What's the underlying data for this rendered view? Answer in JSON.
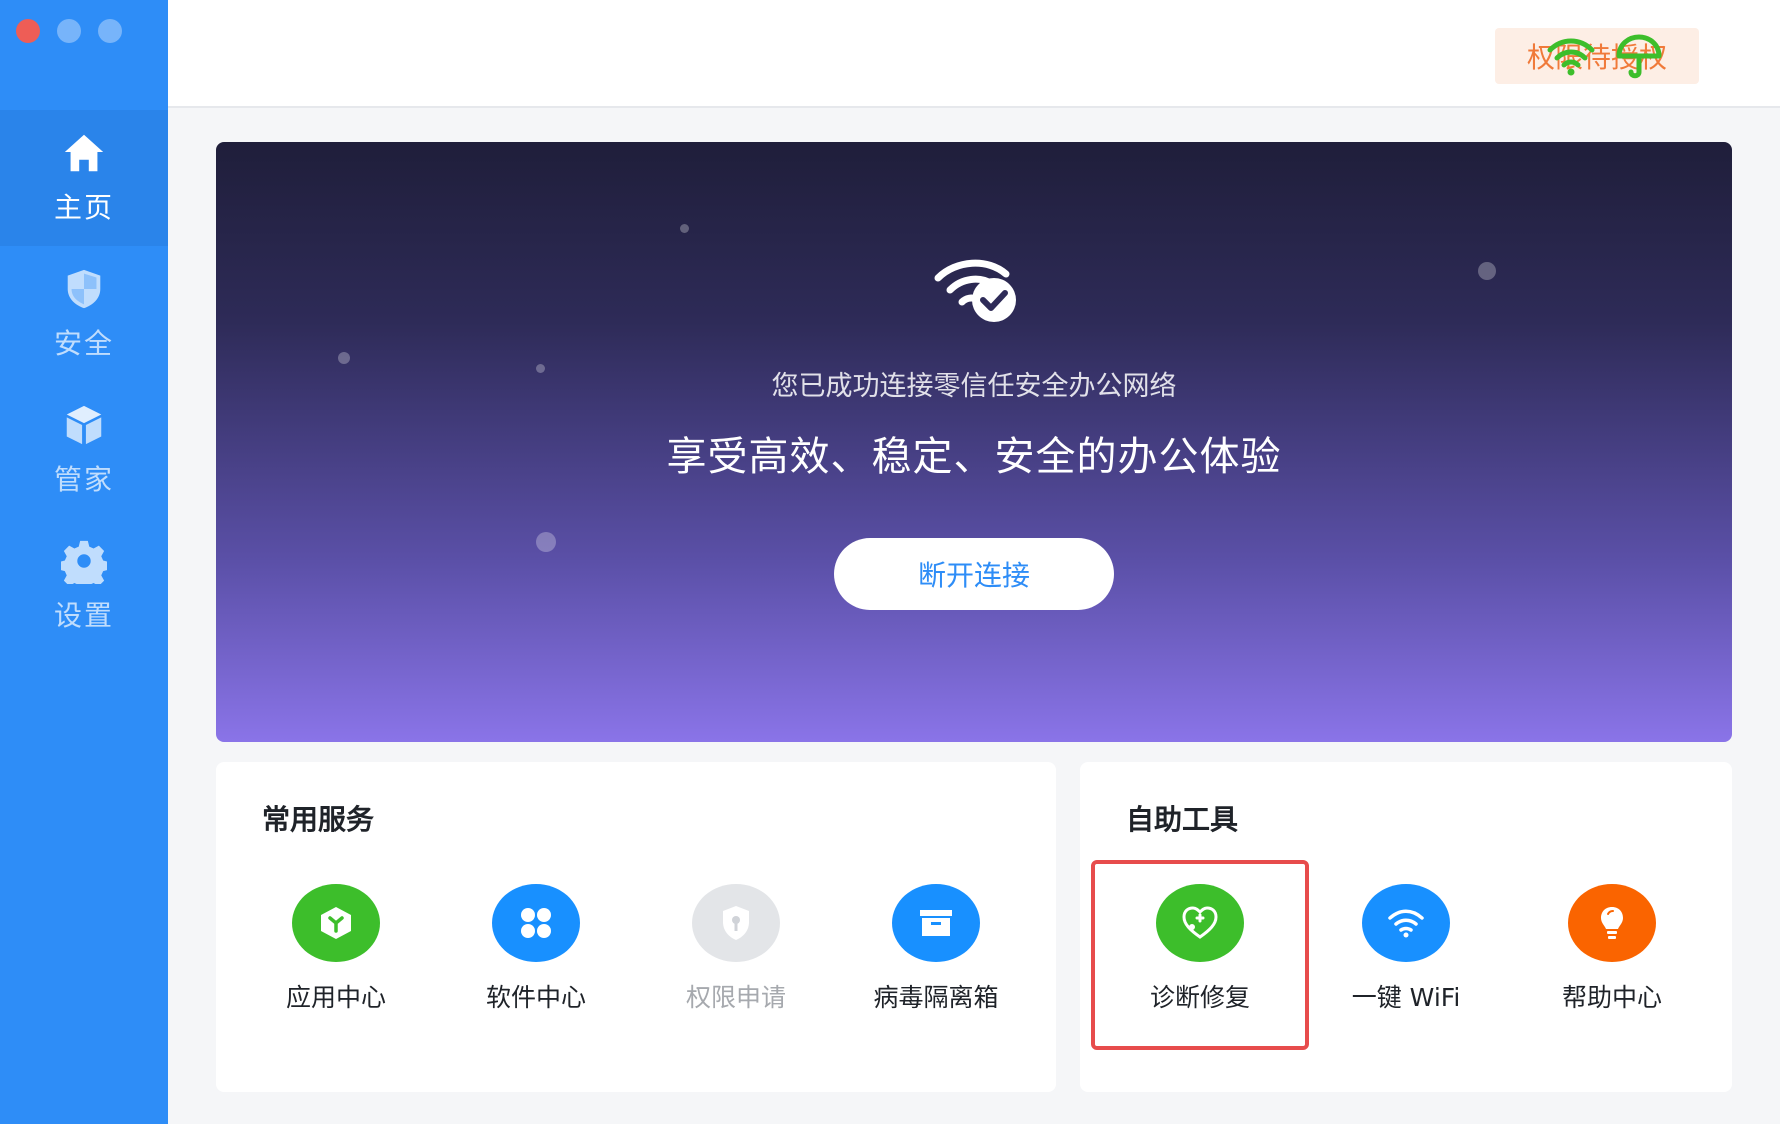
{
  "sidebar": {
    "items": [
      {
        "label": "主页",
        "icon": "home-icon",
        "active": true
      },
      {
        "label": "安全",
        "icon": "shield-icon",
        "active": false
      },
      {
        "label": "管家",
        "icon": "box-icon",
        "active": false
      },
      {
        "label": "设置",
        "icon": "gear-icon",
        "active": false
      }
    ]
  },
  "topbar": {
    "permission_badge": "权限待授权",
    "icons": [
      "wifi-icon",
      "umbrella-icon",
      "avatar"
    ]
  },
  "banner": {
    "subtitle": "您已成功连接零信任安全办公网络",
    "title": "享受高效、稳定、安全的办公体验",
    "disconnect_label": "断开连接"
  },
  "services": {
    "title": "常用服务",
    "items": [
      {
        "label": "应用中心",
        "icon": "app-center-icon",
        "color": "#3dbe2b"
      },
      {
        "label": "软件中心",
        "icon": "software-center-icon",
        "color": "#1890ff"
      },
      {
        "label": "权限申请",
        "icon": "permission-icon",
        "color": "#e3e5e8",
        "disabled": true
      },
      {
        "label": "病毒隔离箱",
        "icon": "quarantine-box-icon",
        "color": "#1890ff"
      }
    ]
  },
  "tools": {
    "title": "自助工具",
    "items": [
      {
        "label": "诊断修复",
        "icon": "diagnose-repair-icon",
        "color": "#3dbe2b",
        "highlighted": true
      },
      {
        "label": "一键 WiFi",
        "icon": "wifi-icon",
        "color": "#1890ff"
      },
      {
        "label": "帮助中心",
        "icon": "lightbulb-icon",
        "color": "#fa6400"
      }
    ]
  },
  "colors": {
    "sidebar": "#2e8df7",
    "accent": "#2e8df7",
    "badge_text": "#f07a3a",
    "badge_bg": "#fdeee5",
    "highlight_border": "#e74c4c",
    "status_green": "#3dbe2b"
  }
}
